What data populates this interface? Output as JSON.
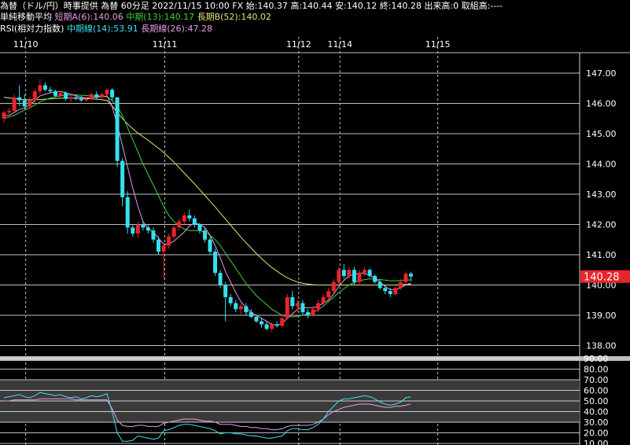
{
  "header": {
    "line1": "為替（ドル/円）時事提供 為替 60分足 2022/11/15 10:00 FX 始:140.37 高:140.44 安:140.12 終:140.28 出来高:0 取組高:----",
    "ma_title": "単純移動平均",
    "ma_short": "短期A(6):140.06",
    "ma_mid": "中期(13):140.17",
    "ma_long": "長期B(52):140.02",
    "rsi_title": "RSI(相対力指数)",
    "rsi_mid": "中期線(14):53.91",
    "rsi_long": "長期線(26):47.28"
  },
  "colors": {
    "background": "#000000",
    "up_candle": "#e8242c",
    "down_candle": "#35e0ee",
    "ma_short": "#e89ce8",
    "ma_mid": "#3ed23e",
    "ma_long": "#e8e27a",
    "rsi_mid": "#3ee0f0",
    "rsi_long": "#e89ce8",
    "price_tag": "#e8242c",
    "grid": "#ffffff"
  },
  "chart_data": {
    "type": "candlestick",
    "interval": "60分足",
    "date_labels": [
      {
        "label": "11/10",
        "index": 3
      },
      {
        "label": "11/11",
        "index": 30
      },
      {
        "label": "11/12",
        "index": 56
      },
      {
        "label": "11/14",
        "index": 64
      },
      {
        "label": "11/15",
        "index": 83
      }
    ],
    "price_axis": {
      "min": 137.7,
      "max": 148.0,
      "ticks": [
        "147.00",
        "146.00",
        "145.00",
        "144.00",
        "143.00",
        "142.00",
        "141.00",
        "140.00",
        "139.00",
        "138.00"
      ]
    },
    "last_price": "140.28",
    "ohlc": [
      [
        145.5,
        145.75,
        145.35,
        145.7
      ],
      [
        145.7,
        145.85,
        145.6,
        145.75
      ],
      [
        145.75,
        146.3,
        145.7,
        146.2
      ],
      [
        146.2,
        146.6,
        145.9,
        146.1
      ],
      [
        146.1,
        146.3,
        145.8,
        145.9
      ],
      [
        145.9,
        146.2,
        145.8,
        146.1
      ],
      [
        146.1,
        146.5,
        146.0,
        146.4
      ],
      [
        146.4,
        146.8,
        146.3,
        146.6
      ],
      [
        146.6,
        146.7,
        146.4,
        146.45
      ],
      [
        146.45,
        146.55,
        146.35,
        146.4
      ],
      [
        146.4,
        146.45,
        146.2,
        146.25
      ],
      [
        146.25,
        146.4,
        146.15,
        146.35
      ],
      [
        146.35,
        146.4,
        146.1,
        146.15
      ],
      [
        146.15,
        146.3,
        146.05,
        146.2
      ],
      [
        146.2,
        146.3,
        146.1,
        146.15
      ],
      [
        146.15,
        146.25,
        146.05,
        146.1
      ],
      [
        146.1,
        146.2,
        146.05,
        146.15
      ],
      [
        146.15,
        146.35,
        146.1,
        146.3
      ],
      [
        146.3,
        146.4,
        146.15,
        146.2
      ],
      [
        146.2,
        146.35,
        146.15,
        146.3
      ],
      [
        146.3,
        146.5,
        146.25,
        146.45
      ],
      [
        146.45,
        146.5,
        146.1,
        146.2
      ],
      [
        146.2,
        146.1,
        143.9,
        144.1
      ],
      [
        144.1,
        144.2,
        142.6,
        142.9
      ],
      [
        142.9,
        143.1,
        141.7,
        141.9
      ],
      [
        141.9,
        142.0,
        141.6,
        141.7
      ],
      [
        141.7,
        142.1,
        141.55,
        142.0
      ],
      [
        142.0,
        142.1,
        141.8,
        141.9
      ],
      [
        141.9,
        142.0,
        141.7,
        141.8
      ],
      [
        141.8,
        141.9,
        141.4,
        141.5
      ],
      [
        141.5,
        141.6,
        141.0,
        141.1
      ],
      [
        141.1,
        141.4,
        140.2,
        141.3
      ],
      [
        141.3,
        141.7,
        141.2,
        141.6
      ],
      [
        141.6,
        142.0,
        141.5,
        141.9
      ],
      [
        141.9,
        142.2,
        141.8,
        142.1
      ],
      [
        142.1,
        142.4,
        142.0,
        142.3
      ],
      [
        142.3,
        142.5,
        142.1,
        142.2
      ],
      [
        142.2,
        142.3,
        141.9,
        142.0
      ],
      [
        142.0,
        142.05,
        141.7,
        141.8
      ],
      [
        141.8,
        141.9,
        141.4,
        141.5
      ],
      [
        141.5,
        141.6,
        141.0,
        141.1
      ],
      [
        141.1,
        141.2,
        140.3,
        140.4
      ],
      [
        140.4,
        140.5,
        139.9,
        140.0
      ],
      [
        140.0,
        140.1,
        138.8,
        139.6
      ],
      [
        139.6,
        139.7,
        139.3,
        139.4
      ],
      [
        139.4,
        139.5,
        139.1,
        139.2
      ],
      [
        139.2,
        139.4,
        139.0,
        139.3
      ],
      [
        139.3,
        139.4,
        139.0,
        139.1
      ],
      [
        139.1,
        139.2,
        138.9,
        138.95
      ],
      [
        138.95,
        139.0,
        138.75,
        138.8
      ],
      [
        138.8,
        138.9,
        138.6,
        138.7
      ],
      [
        138.7,
        138.8,
        138.5,
        138.55
      ],
      [
        138.55,
        138.75,
        138.45,
        138.7
      ],
      [
        138.7,
        138.8,
        138.6,
        138.65
      ],
      [
        138.65,
        139.0,
        138.6,
        138.9
      ],
      [
        138.9,
        139.7,
        138.85,
        139.6
      ],
      [
        139.6,
        139.8,
        139.2,
        139.3
      ],
      [
        139.3,
        139.5,
        139.1,
        139.4
      ],
      [
        139.4,
        139.5,
        139.0,
        139.1
      ],
      [
        139.1,
        139.2,
        138.9,
        139.0
      ],
      [
        139.0,
        139.3,
        138.95,
        139.2
      ],
      [
        139.2,
        139.5,
        139.1,
        139.4
      ],
      [
        139.4,
        139.7,
        139.3,
        139.6
      ],
      [
        139.6,
        139.9,
        139.5,
        139.8
      ],
      [
        139.8,
        140.2,
        139.7,
        140.1
      ],
      [
        140.1,
        140.6,
        140.0,
        140.5
      ],
      [
        140.5,
        140.7,
        140.2,
        140.3
      ],
      [
        140.3,
        140.6,
        140.2,
        140.5
      ],
      [
        140.5,
        140.6,
        140.0,
        140.1
      ],
      [
        140.1,
        140.5,
        140.0,
        140.4
      ],
      [
        140.4,
        140.6,
        140.3,
        140.5
      ],
      [
        140.5,
        140.55,
        140.25,
        140.3
      ],
      [
        140.3,
        140.35,
        140.05,
        140.1
      ],
      [
        140.1,
        140.2,
        139.85,
        139.9
      ],
      [
        139.9,
        140.0,
        139.7,
        139.8
      ],
      [
        139.8,
        139.9,
        139.6,
        139.7
      ],
      [
        139.7,
        139.95,
        139.65,
        139.9
      ],
      [
        139.9,
        140.2,
        139.85,
        140.1
      ],
      [
        140.1,
        140.45,
        140.05,
        140.37
      ],
      [
        140.37,
        140.44,
        140.12,
        140.28
      ]
    ],
    "ma_short": [
      145.6,
      145.6,
      145.7,
      145.8,
      145.85,
      145.95,
      146.1,
      146.25,
      146.3,
      146.35,
      146.38,
      146.4,
      146.35,
      146.3,
      146.25,
      146.2,
      146.18,
      146.2,
      146.2,
      146.22,
      146.25,
      145.9,
      145.3,
      144.6,
      143.9,
      143.2,
      142.6,
      142.1,
      141.85,
      141.75,
      141.55,
      141.35,
      141.35,
      141.45,
      141.6,
      141.75,
      141.95,
      142.05,
      142.0,
      141.9,
      141.65,
      141.3,
      140.9,
      140.45,
      140.1,
      139.75,
      139.45,
      139.25,
      139.1,
      139.0,
      138.9,
      138.8,
      138.7,
      138.68,
      138.72,
      138.9,
      139.05,
      139.2,
      139.25,
      139.25,
      139.25,
      139.3,
      139.4,
      139.5,
      139.7,
      139.95,
      140.15,
      140.3,
      140.35,
      140.4,
      140.38,
      140.32,
      140.22,
      140.1,
      139.95,
      139.85,
      139.85,
      139.9,
      140.0,
      140.06
    ],
    "ma_mid": [
      145.5,
      145.55,
      145.6,
      145.7,
      145.78,
      145.85,
      145.95,
      146.05,
      146.12,
      146.18,
      146.22,
      146.25,
      146.27,
      146.28,
      146.28,
      146.27,
      146.26,
      146.25,
      146.24,
      146.23,
      146.22,
      146.1,
      145.9,
      145.6,
      145.2,
      144.8,
      144.4,
      144.0,
      143.65,
      143.3,
      142.95,
      142.6,
      142.3,
      142.1,
      141.95,
      141.85,
      141.8,
      141.8,
      141.8,
      141.75,
      141.65,
      141.5,
      141.3,
      141.05,
      140.8,
      140.55,
      140.3,
      140.05,
      139.85,
      139.65,
      139.5,
      139.35,
      139.2,
      139.1,
      139.0,
      138.95,
      138.95,
      138.97,
      139.0,
      139.05,
      139.1,
      139.18,
      139.3,
      139.45,
      139.6,
      139.75,
      139.88,
      140.0,
      140.08,
      140.14,
      140.18,
      140.2,
      140.2,
      140.18,
      140.16,
      140.14,
      140.14,
      140.15,
      140.16,
      140.17
    ],
    "ma_long": [
      146.2,
      146.18,
      146.16,
      146.14,
      146.12,
      146.12,
      146.12,
      146.13,
      146.14,
      146.15,
      146.16,
      146.17,
      146.18,
      146.18,
      146.18,
      146.17,
      146.16,
      146.15,
      146.14,
      146.12,
      146.1,
      145.92,
      145.7,
      145.5,
      145.32,
      145.16,
      145.02,
      144.9,
      144.78,
      144.65,
      144.52,
      144.38,
      144.22,
      144.06,
      143.88,
      143.7,
      143.52,
      143.34,
      143.15,
      142.96,
      142.77,
      142.58,
      142.38,
      142.18,
      141.98,
      141.78,
      141.58,
      141.4,
      141.22,
      141.04,
      140.88,
      140.72,
      140.58,
      140.46,
      140.34,
      140.24,
      140.16,
      140.1,
      140.06,
      140.03,
      140.01,
      140.0,
      140.0,
      140.0,
      140.0,
      140.0,
      140.0,
      140.0,
      140.0,
      140.0,
      140.0,
      140.0,
      140.0,
      140.0,
      140.0,
      140.0,
      140.0,
      140.01,
      140.02,
      140.02
    ],
    "rsi_axis": {
      "min": 10,
      "max": 90,
      "ticks": [
        "90.00",
        "80.00",
        "70.00",
        "60.00",
        "50.00",
        "40.00",
        "30.00",
        "20.00",
        "10.00"
      ],
      "bands": [
        30,
        70
      ]
    },
    "rsi_mid": [
      53,
      54,
      55,
      56,
      54,
      53,
      55,
      58,
      57,
      56,
      55,
      56,
      54,
      53,
      54,
      52,
      53,
      55,
      54,
      55,
      57,
      40,
      20,
      12,
      12,
      13,
      17,
      16,
      15,
      14,
      15,
      22,
      23,
      25,
      27,
      28,
      28,
      27,
      26,
      25,
      24,
      22,
      19,
      20,
      20,
      19,
      19,
      18,
      17,
      17,
      16,
      15,
      15,
      16,
      17,
      22,
      24,
      24,
      23,
      23,
      25,
      28,
      33,
      40,
      45,
      50,
      52,
      52,
      53,
      54,
      55,
      54,
      52,
      49,
      47,
      46,
      47,
      49,
      53,
      53.91
    ],
    "rsi_long": [
      50,
      50,
      51,
      51,
      51,
      51,
      51,
      52,
      52,
      52,
      52,
      52,
      52,
      52,
      51,
      51,
      51,
      51,
      51,
      51,
      51,
      43,
      32,
      27,
      26,
      26,
      27,
      27,
      26,
      26,
      26,
      29,
      30,
      31,
      32,
      33,
      33,
      33,
      32,
      31,
      31,
      30,
      28,
      28,
      28,
      27,
      26,
      26,
      25,
      25,
      24,
      24,
      23,
      23,
      24,
      26,
      27,
      27,
      27,
      27,
      28,
      30,
      33,
      37,
      40,
      42,
      44,
      45,
      46,
      47,
      47,
      47,
      46,
      45,
      44,
      44,
      45,
      45,
      46,
      47.28
    ]
  }
}
